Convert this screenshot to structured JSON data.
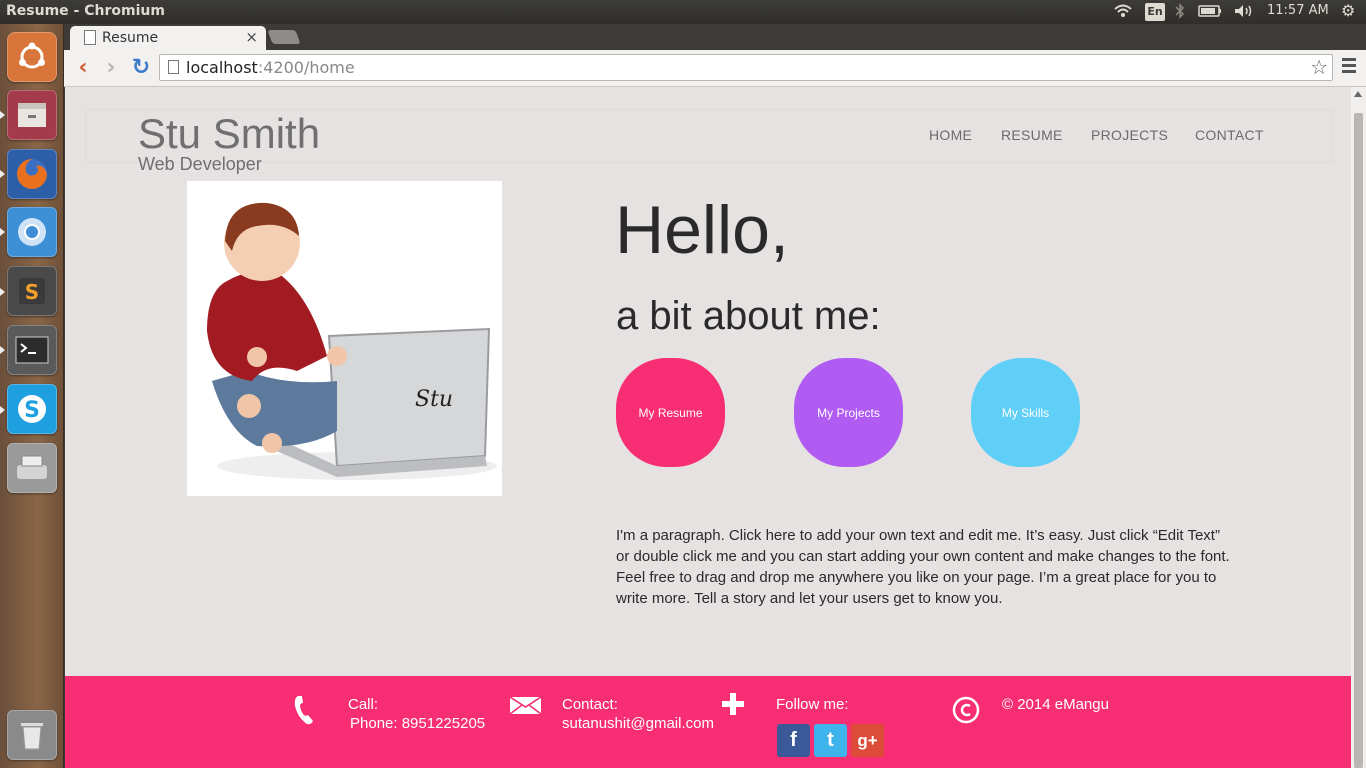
{
  "os": {
    "window_title": "Resume - Chromium",
    "lang": "En",
    "clock": "11:57 AM"
  },
  "launcher": {
    "items": [
      {
        "name": "ubuntu-dash-icon",
        "color": "#d8753b"
      },
      {
        "name": "files-icon",
        "color": "#a33b4a"
      },
      {
        "name": "firefox-icon",
        "color": "#d86a2a"
      },
      {
        "name": "chromium-icon",
        "color": "#3d8fd6"
      },
      {
        "name": "sublime-text-icon",
        "color": "#d88a2a"
      },
      {
        "name": "terminal-icon",
        "color": "#2c2c2c"
      },
      {
        "name": "skype-icon",
        "color": "#1e9fe0"
      },
      {
        "name": "scanner-icon",
        "color": "#9a9a9a"
      },
      {
        "name": "trash-icon",
        "color": "#8a8a8a"
      }
    ]
  },
  "browser": {
    "tab_title": "Resume",
    "url_host": "localhost",
    "url_path": ":4200/home"
  },
  "site": {
    "brand_name": "Stu Smith",
    "brand_role": "Web Developer",
    "nav": [
      "HOME",
      "RESUME",
      "PROJECTS",
      "CONTACT"
    ],
    "photo_signature": "Stu",
    "hello": "Hello,",
    "about": "a bit about me:",
    "buttons": {
      "resume": "My Resume",
      "projects": "My Projects",
      "skills": "My Skills"
    },
    "paragraph": "I'm a paragraph. Click here to add your own text and edit me. It’s easy. Just click “Edit Text” or double click me and you can start adding your own content and make changes to the font. Feel free to drag and drop me anywhere you like on your page. I’m a great place for you to write more. Tell a story and let your users get to know you."
  },
  "footer": {
    "call_label": "Call:",
    "phone": "Phone: 8951225205",
    "contact_label": "Contact:",
    "email": "sutanushit@gmail.com",
    "follow_label": "Follow me:",
    "copyright": "© 2014 eMangu",
    "social": [
      "f",
      "t",
      "g+"
    ],
    "accent": "#f72e74"
  }
}
